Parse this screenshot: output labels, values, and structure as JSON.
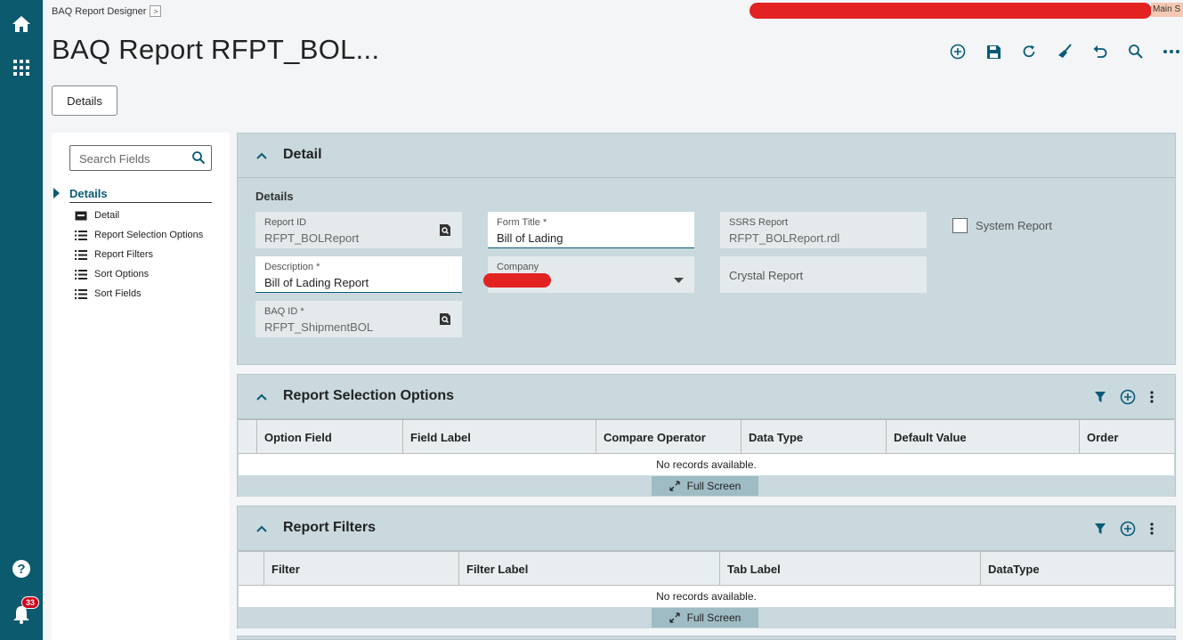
{
  "header": {
    "breadcrumb": "BAQ Report Designer",
    "breadcrumb_chevron": ">",
    "title": "BAQ Report RFPT_BOL...",
    "main_label": "Main S",
    "details_button": "Details"
  },
  "rail": {
    "notification_count": "33"
  },
  "nav": {
    "search_placeholder": "Search Fields",
    "section": "Details",
    "items": [
      {
        "label": "Detail",
        "icon": "detail-card-icon"
      },
      {
        "label": "Report Selection Options",
        "icon": "list-icon"
      },
      {
        "label": "Report Filters",
        "icon": "list-icon"
      },
      {
        "label": "Sort Options",
        "icon": "list-icon"
      },
      {
        "label": "Sort Fields",
        "icon": "list-icon"
      }
    ]
  },
  "detail": {
    "title": "Detail",
    "subtitle": "Details",
    "report_id": {
      "label": "Report ID",
      "value": "RFPT_BOLReport"
    },
    "form_title": {
      "label": "Form Title *",
      "value": "Bill of Lading"
    },
    "ssrs_report": {
      "label": "SSRS Report",
      "value": "RFPT_BOLReport.rdl"
    },
    "system_report": {
      "label": "System Report",
      "checked": false
    },
    "description": {
      "label": "Description *",
      "value": "Bill of Lading Report"
    },
    "company": {
      "label": "Company",
      "value": ""
    },
    "crystal_report": {
      "label": "Crystal Report"
    },
    "baq_id": {
      "label": "BAQ ID *",
      "value": "RFPT_ShipmentBOL"
    }
  },
  "selection_options": {
    "title": "Report Selection Options",
    "columns": [
      "Option Field",
      "Field Label",
      "Compare Operator",
      "Data Type",
      "Default Value",
      "Order"
    ],
    "empty_text": "No records available.",
    "fullscreen_label": "Full Screen"
  },
  "filters": {
    "title": "Report Filters",
    "columns": [
      "Filter",
      "Filter Label",
      "Tab Label",
      "DataType"
    ],
    "empty_text": "No records available.",
    "fullscreen_label": "Full Screen"
  },
  "colors": {
    "rail": "#0b5a6e",
    "accent": "#0a5a78",
    "card_bg": "#c9d9dd",
    "field_bg": "#e4eaec",
    "redaction": "#e32222"
  }
}
